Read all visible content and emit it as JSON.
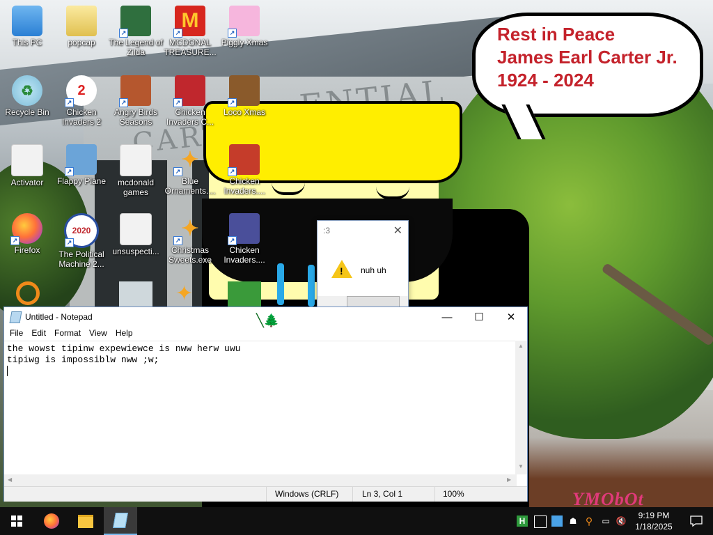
{
  "wallpaper": {
    "building_text": "CARTE",
    "building_text_top": "ENTIAL",
    "bubble_lines": "Rest in Peace\nJames Earl Carter Jr.\n1924 - 2024",
    "watermark": "YMObOt",
    "bubble_color": "#c4222b"
  },
  "desktop_icons": [
    {
      "label": "This PC",
      "icon": "computer-icon"
    },
    {
      "label": "popcap",
      "icon": "folder-icon"
    },
    {
      "label": "The Legend of Zilda",
      "icon": "game-icon"
    },
    {
      "label": "MCDONAL TREASURE...",
      "icon": "mcdonalds-icon"
    },
    {
      "label": "Piggly Xmas",
      "icon": "pig-icon"
    },
    {
      "label": "Recycle Bin",
      "icon": "recycle-bin-icon"
    },
    {
      "label": "Chicken Invaders 2",
      "icon": "chicken-icon"
    },
    {
      "label": "Angry Birds Seasons",
      "icon": "angry-birds-icon"
    },
    {
      "label": "Chicken Invaders C...",
      "icon": "chicken-icon"
    },
    {
      "label": "Loco Xmas",
      "icon": "bear-icon"
    },
    {
      "label": "Activator",
      "icon": "file-icon"
    },
    {
      "label": "Flappy Plane",
      "icon": "plane-icon"
    },
    {
      "label": "mcdonald games",
      "icon": "file-icon"
    },
    {
      "label": "Blue Ornaments....",
      "icon": "puzzle-icon"
    },
    {
      "label": "Chicken Invaders....",
      "icon": "chicken-icon"
    },
    {
      "label": "Firefox",
      "icon": "firefox-icon"
    },
    {
      "label": "The Political Machine 2...",
      "icon": "political-icon"
    },
    {
      "label": "unsuspecti...",
      "icon": "file-icon"
    },
    {
      "label": "Christmas Sweets.exe",
      "icon": "puzzle-icon"
    },
    {
      "label": "Chicken Invaders....",
      "icon": "chicken-icon"
    }
  ],
  "msgbox": {
    "title": ":3",
    "text": "nuh uh",
    "close": "✕"
  },
  "notepad": {
    "title": "Untitled - Notepad",
    "menu": [
      "File",
      "Edit",
      "Format",
      "View",
      "Help"
    ],
    "line1": "the wowst tipinw expewiewce is nww herw uwu",
    "line2": "tipiwg is impossiblw nww ;w;",
    "status_eol": "Windows (CRLF)",
    "status_pos": "Ln 3, Col 1",
    "status_zoom": "100%",
    "minimize": "—",
    "maximize": "☐",
    "close": "✕"
  },
  "taskbar": {
    "time": "9:19 PM",
    "date": "1/18/2025",
    "accent": "#76b9ed"
  }
}
